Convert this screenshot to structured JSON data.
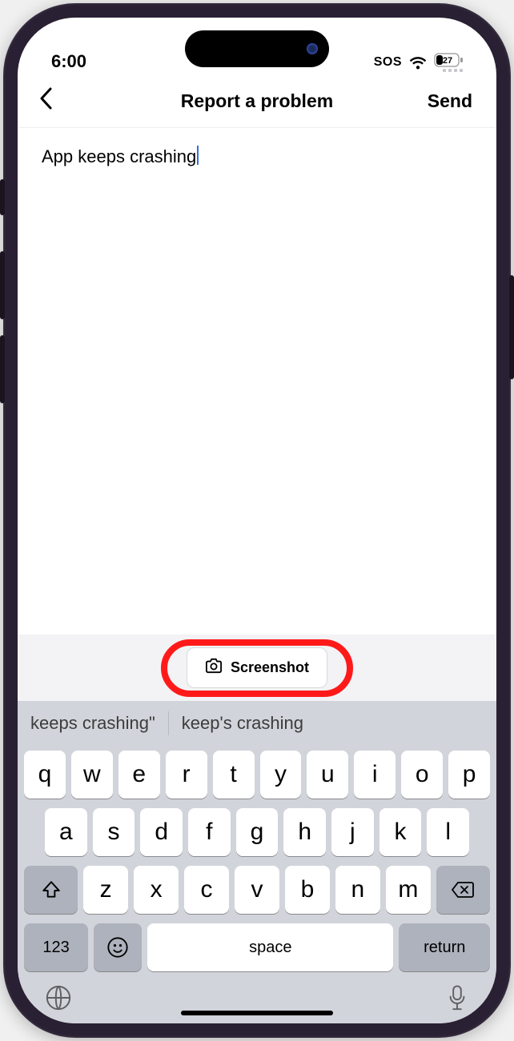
{
  "status": {
    "time": "6:00",
    "sos": "SOS",
    "battery_pct": "27"
  },
  "nav": {
    "title": "Report a problem",
    "send": "Send"
  },
  "content": {
    "text": "App keeps crashing"
  },
  "toolbar": {
    "screenshot": "Screenshot"
  },
  "suggestions": {
    "s1": "keeps crashing\"",
    "s2": "keep's crashing"
  },
  "keyboard": {
    "row1": [
      "q",
      "w",
      "e",
      "r",
      "t",
      "y",
      "u",
      "i",
      "o",
      "p"
    ],
    "row2": [
      "a",
      "s",
      "d",
      "f",
      "g",
      "h",
      "j",
      "k",
      "l"
    ],
    "row3": [
      "z",
      "x",
      "c",
      "v",
      "b",
      "n",
      "m"
    ],
    "num": "123",
    "space": "space",
    "return": "return"
  }
}
